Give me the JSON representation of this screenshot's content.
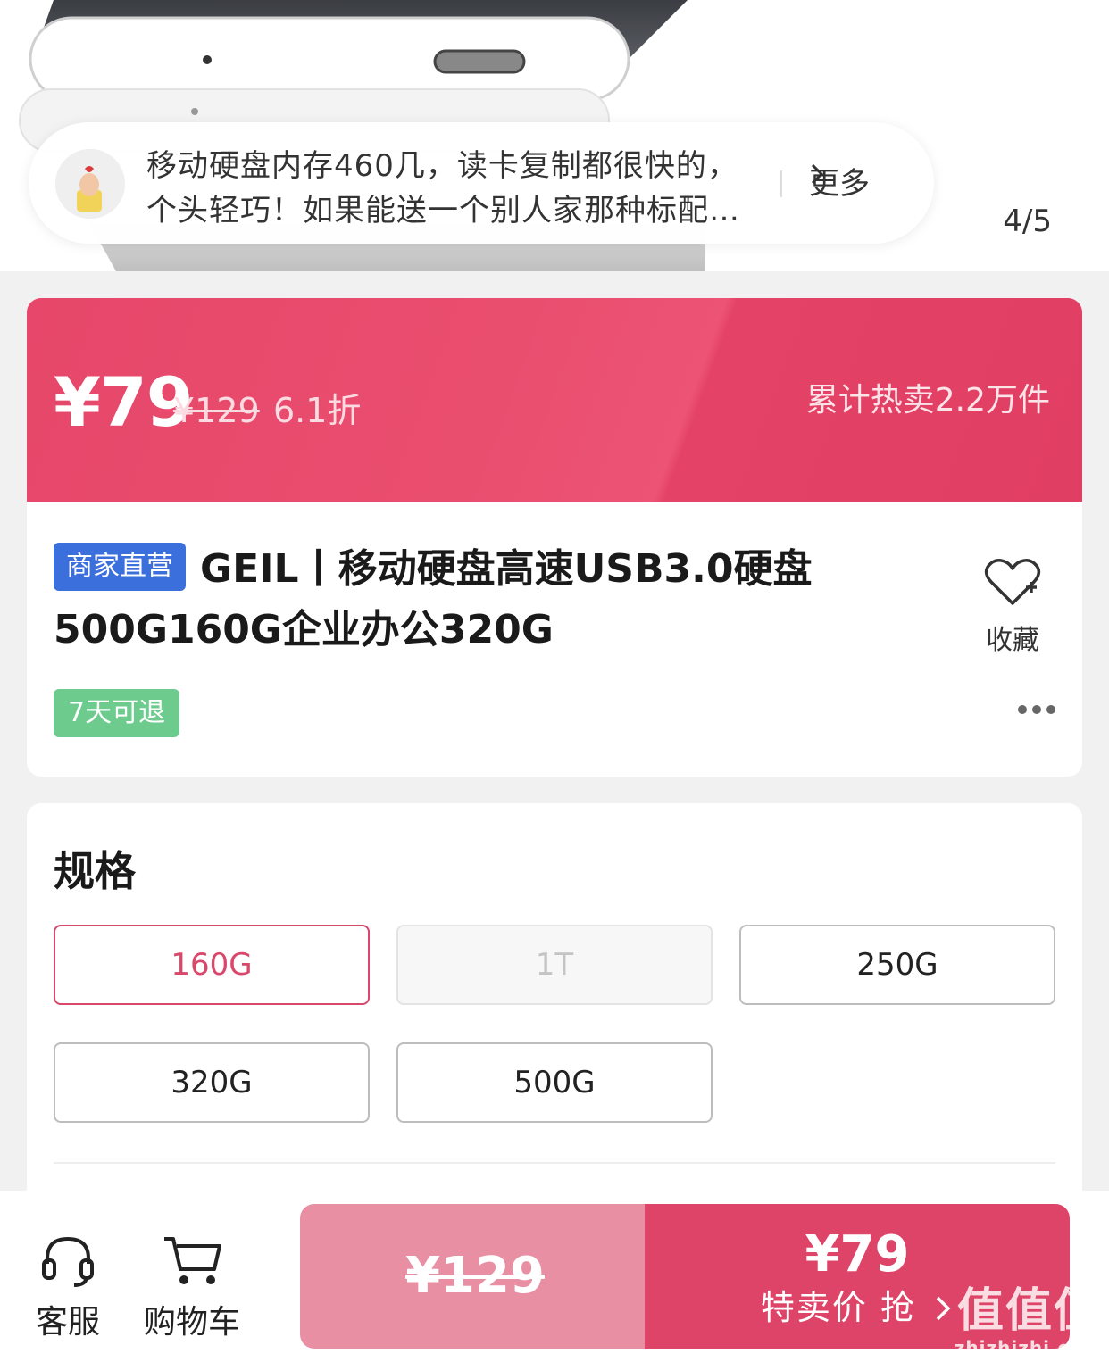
{
  "hero": {
    "review": {
      "line1": "移动硬盘内存460几，读卡复制都很快的，",
      "line2": "个头轻巧！如果能送一个别人家那种标配…",
      "more_label": "更多"
    },
    "image_counter": "4/5"
  },
  "price": {
    "current": "¥79",
    "original": "¥129",
    "discount": "6.1折",
    "sales": "累计热卖2.2万件"
  },
  "product": {
    "badge": "商家直营",
    "title": "GEIL丨移动硬盘高速USB3.0硬盘500G160G企业办公320G",
    "favorite_label": "收藏",
    "return_badge": "7天可退"
  },
  "spec": {
    "title": "规格",
    "options": [
      {
        "label": "160G",
        "state": "selected"
      },
      {
        "label": "1T",
        "state": "disabled"
      },
      {
        "label": "250G",
        "state": "normal"
      },
      {
        "label": "320G",
        "state": "normal"
      },
      {
        "label": "500G",
        "state": "normal"
      }
    ]
  },
  "bottom_bar": {
    "service_label": "客服",
    "cart_label": "购物车",
    "original_price": "¥129",
    "special_price": "¥79",
    "special_label": "特卖价 抢"
  },
  "watermark": {
    "main": "值值值",
    "sub": "zhizhizhi.com"
  },
  "colors": {
    "accent": "#de4467",
    "banner": "#e6476a",
    "direct_badge": "#3b6fdc",
    "return_badge": "#6ecb8e"
  }
}
